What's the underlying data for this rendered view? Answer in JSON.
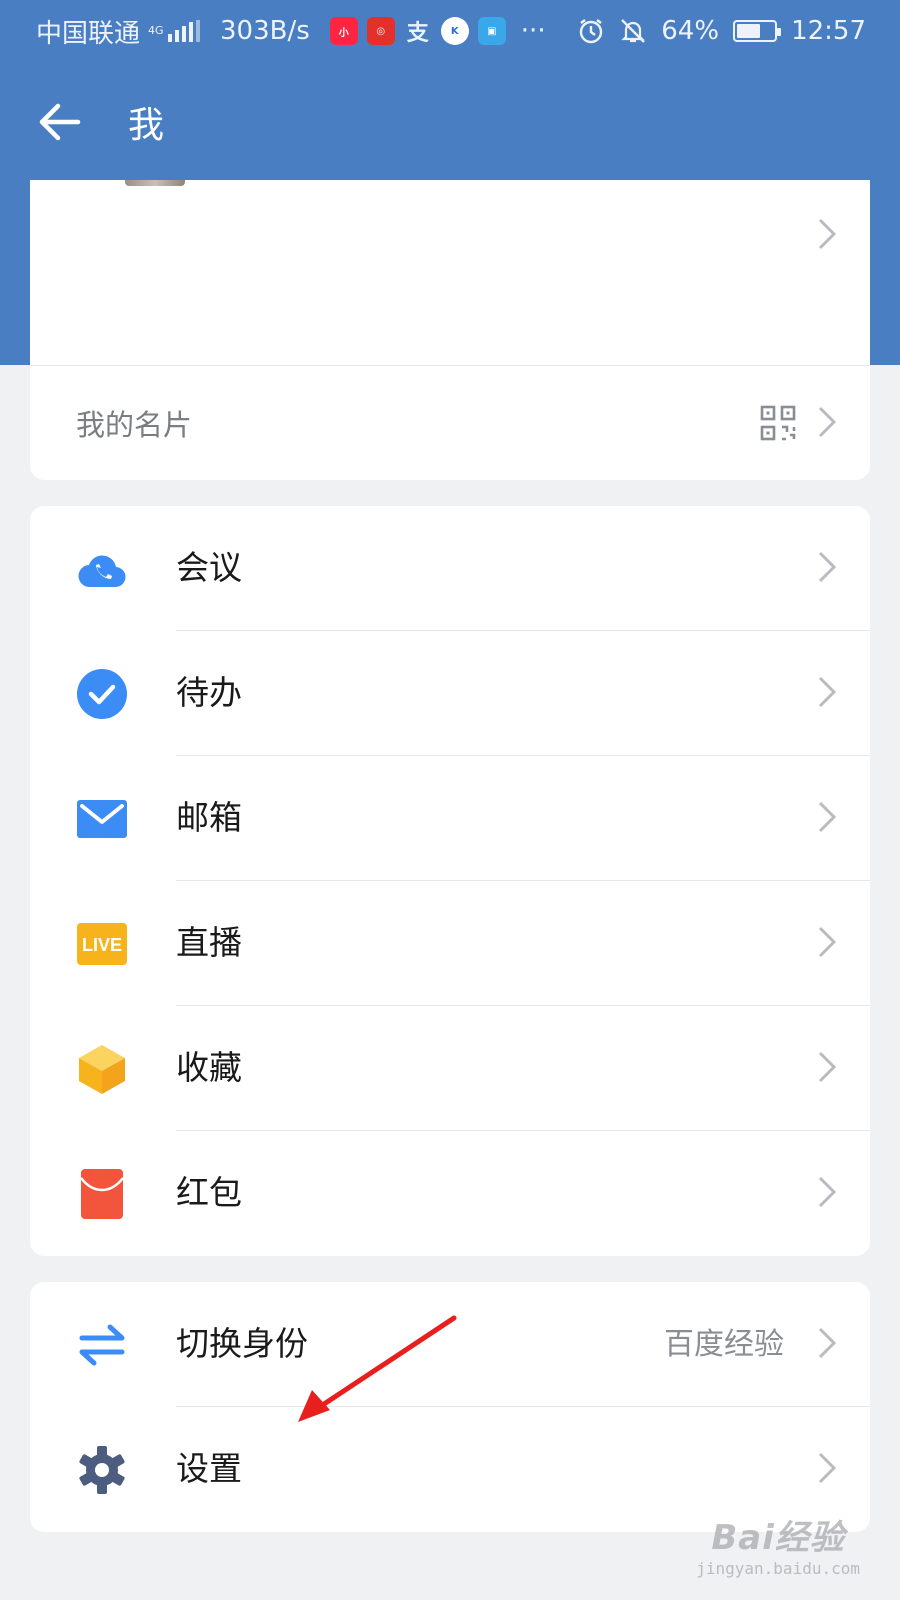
{
  "status_bar": {
    "carrier": "中国联通",
    "network_type": "4G",
    "net_speed": "303B/s",
    "app_icons": [
      "xiaohongshu-icon",
      "app-red-icon",
      "alipay-icon",
      "k-app-icon",
      "delivery-app-icon"
    ],
    "more": "···",
    "battery_percent": "64%",
    "battery_level": 0.64,
    "time": "12:57"
  },
  "header": {
    "title": "我"
  },
  "profile": {
    "name_card_label": "我的名片"
  },
  "menu": {
    "items": [
      {
        "label": "会议",
        "icon": "meeting-cloud-phone-icon",
        "color": "#3b8cf5"
      },
      {
        "label": "待办",
        "icon": "todo-check-icon",
        "color": "#3b8cf5"
      },
      {
        "label": "邮箱",
        "icon": "mail-icon",
        "color": "#3b8cf5"
      },
      {
        "label": "直播",
        "icon": "live-icon",
        "color": "#f7b31b"
      },
      {
        "label": "收藏",
        "icon": "favorites-cube-icon",
        "color": "#f7c53a"
      },
      {
        "label": "红包",
        "icon": "red-envelope-icon",
        "color": "#f2553b"
      }
    ]
  },
  "settings_group": {
    "switch_identity_label": "切换身份",
    "switch_identity_value": "百度经验",
    "settings_label": "设置"
  },
  "icons": {
    "live_text": "LIVE"
  },
  "watermark": {
    "main": "Bai经验",
    "sub": "jingyan.baidu.com"
  },
  "colors": {
    "header_blue": "#4a7ec2",
    "page_background": "#f0f1f3",
    "annotation_arrow": "#e8201d"
  }
}
